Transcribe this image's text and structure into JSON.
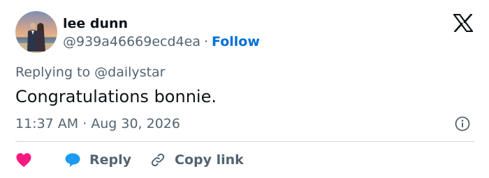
{
  "user": {
    "display_name": "lee dunn",
    "handle": "@939a46669ecd4ea",
    "separator": "·",
    "follow_label": "Follow"
  },
  "reply_context": {
    "prefix": "Replying to",
    "mention": "@dailystar"
  },
  "tweet": {
    "text": "Congratulations bonnie.",
    "time": "11:37 AM",
    "separator": "·",
    "date": "Aug 30, 2026"
  },
  "actions": {
    "reply_label": "Reply",
    "copy_link_label": "Copy link"
  },
  "icons": {
    "brand": "x-logo-icon",
    "info": "info-icon",
    "like": "heart-icon",
    "reply": "speech-bubble-icon",
    "copy": "link-icon"
  },
  "colors": {
    "text_primary": "#0f1419",
    "text_secondary": "#536471",
    "link_blue": "#006fd6",
    "like_pink": "#f91880",
    "reply_blue": "#1d9bf0",
    "divider": "#cfd9de"
  }
}
